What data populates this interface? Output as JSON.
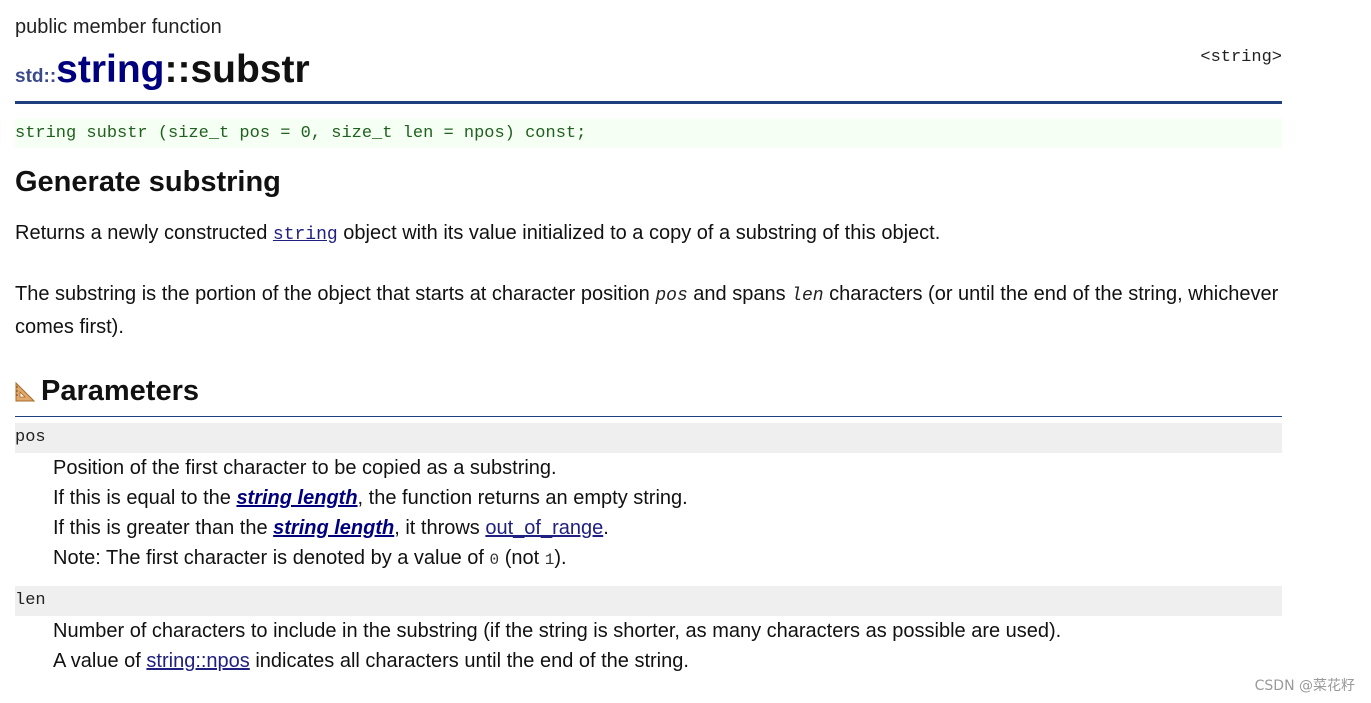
{
  "page": {
    "kind": "public member function",
    "header_ref": "<string>",
    "title": {
      "namespace": "std::",
      "class_name": "string",
      "separator": "::",
      "function": "substr"
    },
    "prototype": "string substr (size_t pos = 0, size_t len = npos) const;",
    "section_title": "Generate substring",
    "description": {
      "p1": {
        "before": "Returns a newly constructed ",
        "link": "string",
        "after": " object with its value initialized to a copy of a substring of this object."
      },
      "p2": {
        "part1": "The substring is the portion of the object that starts at character position ",
        "var1": "pos",
        "part2": " and spans ",
        "var2": "len",
        "part3": " characters (or until the end of the string, whichever comes first)."
      }
    },
    "parameters_heading": "Parameters",
    "parameters": {
      "pos": {
        "name": "pos",
        "line1": "Position of the first character to be copied as a substring.",
        "line2": {
          "before": "If this is equal to the ",
          "link": "string length",
          "after": ", the function returns an empty string."
        },
        "line3": {
          "before": "If this is greater than the ",
          "link": "string length",
          "middle": ", it throws ",
          "link2": "out_of_range",
          "after": "."
        },
        "line4": {
          "before": "Note: The first character is denoted by a value of ",
          "code1": "0",
          "middle": " (not ",
          "code2": "1",
          "after": ")."
        }
      },
      "len": {
        "name": "len",
        "line1": "Number of characters to include in the substring (if the string is shorter, as many characters as possible are used).",
        "line2": {
          "before": "A value of ",
          "link": "string::npos",
          "after": " indicates all characters until the end of the string."
        }
      }
    }
  },
  "watermark": "CSDN @菜花籽",
  "icons": {
    "parameters": "ruler-triangle-icon"
  },
  "colors": {
    "title_blue": "#00007f",
    "rule_blue": "#1f3f7f",
    "prototype_bg": "#f6fff3",
    "prototype_text": "#206020",
    "param_bg": "#efefef"
  }
}
